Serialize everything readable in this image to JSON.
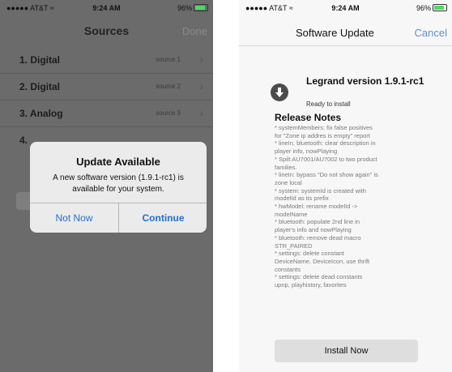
{
  "status_bar": {
    "carrier": "●●●●● AT&T",
    "time": "9:24 AM",
    "battery": "96%"
  },
  "left_screen": {
    "title": "Sources",
    "done_label": "Done",
    "rows": [
      {
        "label": "1. Digital",
        "source": "source 1"
      },
      {
        "label": "2. Digital",
        "source": "source 2"
      },
      {
        "label": "3. Analog",
        "source": "source 3"
      },
      {
        "label": "4. ",
        "source": ""
      }
    ],
    "alert": {
      "title": "Update Available",
      "message": "A new software version (1.9.1-rc1) is available for your system.",
      "not_now_label": "Not Now",
      "continue_label": "Continue"
    }
  },
  "right_screen": {
    "title": "Software Update",
    "cancel_label": "Cancel",
    "app_name": "Legrand version 1.9.1-rc1",
    "status": "Ready to install",
    "release_notes_title": "Release Notes",
    "release_notes": [
      "* systemMembers: fix false positives",
      "for \"Zone ip addres is empty\" report",
      "* lineIn, bluetooth: clear description in",
      "player info, nowPlaying",
      "* Spilt AU7001/AU7002 to two product",
      "families.",
      "* lineIn: bypass \"Do not show again\" is",
      "zone local",
      "* system: systemId is created with",
      "modelId as its prefix",
      "* hwModel: rename modelId ->",
      "modelName",
      "* bluetooth: populate 2nd line in",
      "player's info and nowPlaying",
      "* bluetooth: remove dead macro",
      "STR_PAIRED",
      "* settings: delete constant",
      "DeviceName, DeviceIcon, use thrift",
      "constants",
      "* settings: delete dead constants",
      "upnp, playhistory, favorites"
    ],
    "install_label": "Install Now"
  },
  "colors": {
    "accent_blue": "#1f6fd6",
    "cancel_blue": "#5b8fd8",
    "battery_green": "#4cd964",
    "dimmed_background": "#6b6b6b"
  },
  "icons": [
    "wifi-icon",
    "battery-icon",
    "chevron-right-icon",
    "download-arrow-icon"
  ]
}
